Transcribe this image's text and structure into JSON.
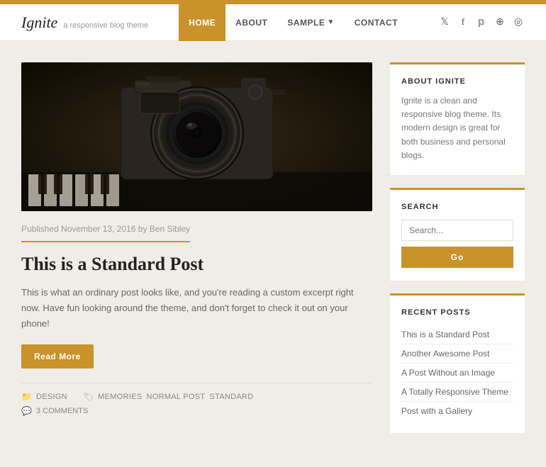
{
  "topbar": {},
  "header": {
    "logo": {
      "title": "Ignite",
      "tagline": "a responsive blog theme"
    },
    "nav": {
      "items": [
        {
          "label": "HOME",
          "active": true,
          "has_dropdown": false
        },
        {
          "label": "ABOUT",
          "active": false,
          "has_dropdown": false
        },
        {
          "label": "SAMPLE",
          "active": false,
          "has_dropdown": true
        },
        {
          "label": "CONTACT",
          "active": false,
          "has_dropdown": false
        }
      ]
    },
    "social": {
      "icons": [
        "twitter",
        "facebook",
        "pinterest",
        "rss",
        "instagram"
      ]
    }
  },
  "post": {
    "meta": "Published November 13, 2016 by Ben Sibley",
    "title": "This is a Standard Post",
    "excerpt": "This is what an ordinary post looks like, and you're reading a custom excerpt right now. Have fun looking around the theme, and don't forget to check it out on your phone!",
    "read_more": "Read More",
    "categories_label": "",
    "categories": [
      "DESIGN"
    ],
    "tags_label": "",
    "tags": [
      "MEMORIES",
      "NORMAL POST",
      "STANDARD"
    ],
    "comments_label": "3 COMMENTS"
  },
  "sidebar": {
    "about_widget": {
      "title": "ABOUT IGNITE",
      "text": "Ignite is a clean and responsive blog theme. Its modern design is great for both business and personal blogs."
    },
    "search_widget": {
      "title": "SEARCH",
      "placeholder": "Search...",
      "go_label": "Go"
    },
    "recent_posts_widget": {
      "title": "RECENT POSTS",
      "items": [
        "This is a Standard Post",
        "Another Awesome Post",
        "A Post Without an Image",
        "A Totally Responsive Theme",
        "Post with a Gallery"
      ]
    }
  },
  "colors": {
    "accent": "#c9922a",
    "bg": "#f0ede8",
    "white": "#ffffff"
  }
}
